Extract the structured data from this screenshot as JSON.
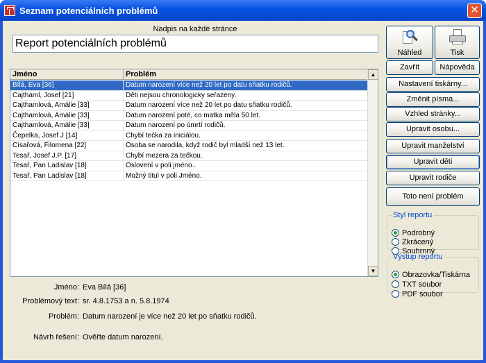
{
  "window": {
    "title": "Seznam potenciálních problémů"
  },
  "header": {
    "label": "Nadpis na každé stránce",
    "value": "Report potenciálních problémů"
  },
  "grid": {
    "columns": [
      "Jméno",
      "Problém"
    ],
    "rows": [
      [
        "Bílá, Eva [36]",
        "Datum narození více než 20 let po datu sňatku rodičů."
      ],
      [
        "Cajthaml, Josef [21]",
        "Děti nejsou chronologicky seřazeny."
      ],
      [
        "Cajthamlová, Amálie [33]",
        "Datum narození více než 20 let po datu sňatku rodičů."
      ],
      [
        "Cajthamlová, Amálie [33]",
        "Datum narození poté, co matka měla 50 let."
      ],
      [
        "Cajthamlová, Amálie [33]",
        "Datum narození po úmrtí rodičů."
      ],
      [
        "Čepelka, Josef J [14]",
        "Chybí tečka za iniciálou."
      ],
      [
        "Císařová, Filomena [22]",
        "Osoba se narodila, když rodič byl mladší než 13 let."
      ],
      [
        "Tesař, Josef J.P. [17]",
        "Chybí mezera za tečkou."
      ],
      [
        "Tesař, Pan Ladislav [18]",
        "Oslovení v poli jméno.."
      ],
      [
        "Tesař, Pan Ladislav [18]",
        "Možný titul v poli Jméno."
      ]
    ]
  },
  "details": {
    "name_label": "Jméno:",
    "name_value": "Eva Bílá [36]",
    "text_label": "Problémový text:",
    "text_value": "sr. 4.8.1753 a n. 5.8.1974",
    "problem_label": "Problém:",
    "problem_value": "Datum narození je více než 20 let po sňatku rodičů.",
    "solution_label": "Návrh řešení:",
    "solution_value": "Ověřte datum narození."
  },
  "buttons": {
    "preview": "Náhled",
    "print": "Tisk",
    "close": "Zavřít",
    "help": "Nápověda",
    "printer_setup": "Nastavení tiskárny...",
    "change_fonts": "Změnit písma...",
    "page_layout": "Vzhled stránky...",
    "edit_person": "Upravit osobu...",
    "edit_marriage": "Upravit manželství",
    "edit_children": "Upravit děti",
    "edit_parents": "Upravit rodiče",
    "not_problem": "Toto není problém"
  },
  "report_style": {
    "legend": "Styl reportu",
    "options": [
      "Podrobný",
      "Zkrácený",
      "Souhrnný"
    ],
    "selected": 0
  },
  "report_output": {
    "legend": "Výstup reportu",
    "options": [
      "Obrazovka/Tiskárna",
      "TXT soubor",
      "PDF soubor"
    ],
    "selected": 0
  }
}
